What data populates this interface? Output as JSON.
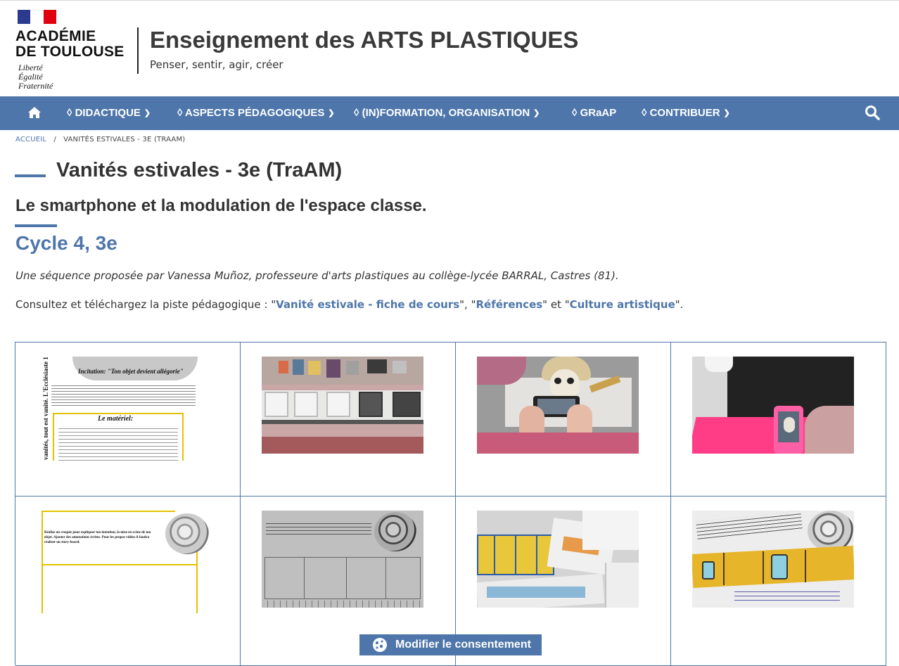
{
  "header": {
    "academy_line1": "ACADÉMIE",
    "academy_line2": "DE TOULOUSE",
    "motto": [
      "Liberté",
      "Égalité",
      "Fraternité"
    ],
    "site_title": "Enseignement des ARTS PLASTIQUES",
    "site_subtitle": "Penser, sentir, agir, créer"
  },
  "nav": {
    "home_icon": "home-icon",
    "items": [
      {
        "label": "◊ DIDACTIQUE",
        "dropdown": true
      },
      {
        "label": "◊ ASPECTS PÉDAGOGIQUES",
        "dropdown": true
      },
      {
        "label": "◊ (IN)FORMATION, ORGANISATION",
        "dropdown": true
      },
      {
        "label": "◊ GRaAP",
        "dropdown": false
      },
      {
        "label": "◊ CONTRIBUER",
        "dropdown": true
      }
    ],
    "search_icon": "search-icon",
    "color": "#4e76aa"
  },
  "breadcrumb": {
    "home": "ACCUEIL",
    "separator": "/",
    "current": "VANITÉS ESTIVALES - 3E (TRAAM)"
  },
  "article": {
    "title": "Vanités estivales - 3e (TraAM)",
    "subtitle": "Le smartphone et la modulation de l'espace classe.",
    "level": "Cycle 4, 3e",
    "intro": "Une séquence proposée par Vanessa Muñoz, professeure d'arts plastiques au collège-lycée BARRAL, Castres (81).",
    "consult_prefix": "Consultez et téléchargez la piste pédagogique : \"",
    "link1": "Vanité estivale - fiche de cours",
    "mid1": "\", \"",
    "link2": "Références",
    "mid2": "\" et \"",
    "link3": "Culture artistique",
    "consult_suffix": "\"."
  },
  "gallery": {
    "doc1": {
      "side_text": "vanités, tout est vanité. L'Ecclésiaste 1",
      "heading": "Incitation: \"Ton objet devient allégorie\"",
      "materiel": "Le matériel:"
    },
    "doc2": {
      "line1": "Réalise un croquis pour expliquer ton intention, la mise en scène de ton",
      "line2": "objet. Ajouter des annotations écrites. Pour les propos vidéos il faudra",
      "line3": "réaliser un story-board."
    }
  },
  "consent": {
    "label": "Modifier le consentement",
    "icon": "cookie-icon"
  }
}
